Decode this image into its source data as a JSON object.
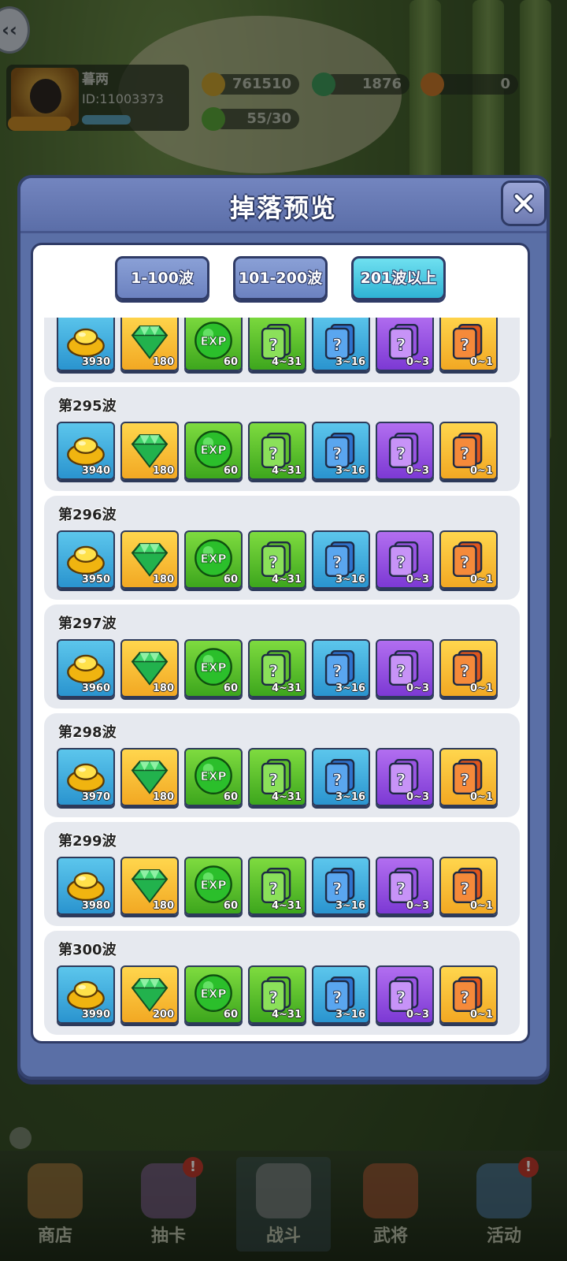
{
  "player": {
    "name": "暮两",
    "id": "ID:11003373"
  },
  "resources": {
    "gold": "761510",
    "gems": "1876",
    "other": "0",
    "stamina": "55/30"
  },
  "bottom_nav": [
    {
      "label": "商店"
    },
    {
      "label": "抽卡"
    },
    {
      "label": "战斗"
    },
    {
      "label": "武将"
    },
    {
      "label": "活动"
    }
  ],
  "modal": {
    "title": "掉落预览",
    "tabs": [
      {
        "label": "1-100波",
        "active": false
      },
      {
        "label": "101-200波",
        "active": false
      },
      {
        "label": "201波以上",
        "active": true
      }
    ]
  },
  "waves": [
    {
      "title": "",
      "items": [
        "3930",
        "180",
        "60",
        "4~31",
        "3~16",
        "0~3",
        "0~1"
      ]
    },
    {
      "title": "第295波",
      "items": [
        "3940",
        "180",
        "60",
        "4~31",
        "3~16",
        "0~3",
        "0~1"
      ]
    },
    {
      "title": "第296波",
      "items": [
        "3950",
        "180",
        "60",
        "4~31",
        "3~16",
        "0~3",
        "0~1"
      ]
    },
    {
      "title": "第297波",
      "items": [
        "3960",
        "180",
        "60",
        "4~31",
        "3~16",
        "0~3",
        "0~1"
      ]
    },
    {
      "title": "第298波",
      "items": [
        "3970",
        "180",
        "60",
        "4~31",
        "3~16",
        "0~3",
        "0~1"
      ]
    },
    {
      "title": "第299波",
      "items": [
        "3980",
        "180",
        "60",
        "4~31",
        "3~16",
        "0~3",
        "0~1"
      ]
    },
    {
      "title": "第300波",
      "items": [
        "3990",
        "200",
        "60",
        "4~31",
        "3~16",
        "0~3",
        "0~1"
      ]
    }
  ],
  "item_icons": [
    "gold-ingot-icon",
    "green-gem-icon",
    "exp-orb-icon",
    "green-mystery-card-icon",
    "blue-mystery-card-icon",
    "purple-mystery-card-icon",
    "orange-mystery-card-icon"
  ],
  "exp_text": "EXP",
  "colors": {
    "modal_bg": "#5a6fa6",
    "active_tab": "#2fb3d4",
    "tab": "#6c82c0"
  }
}
